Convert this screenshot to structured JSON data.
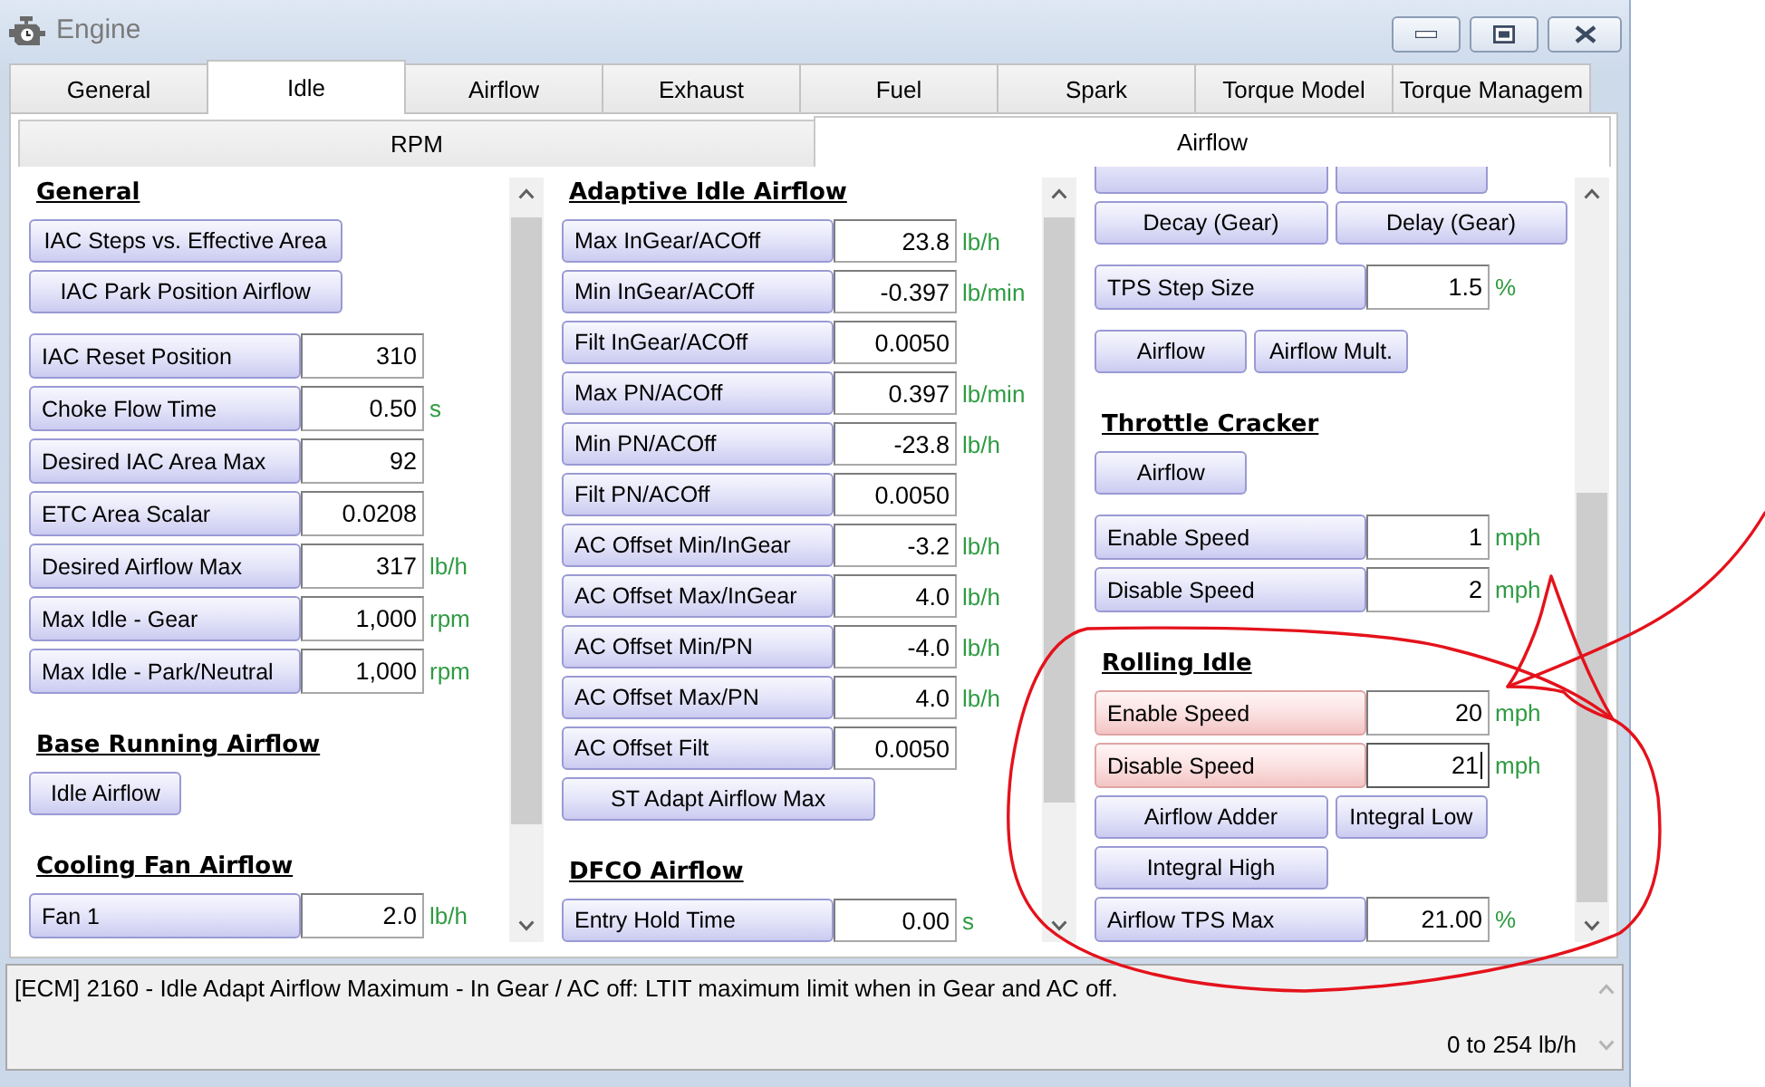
{
  "window": {
    "title": "Engine"
  },
  "tabs": [
    {
      "label": "General",
      "selected": false
    },
    {
      "label": "Idle",
      "selected": true
    },
    {
      "label": "Airflow",
      "selected": false
    },
    {
      "label": "Exhaust",
      "selected": false
    },
    {
      "label": "Fuel",
      "selected": false
    },
    {
      "label": "Spark",
      "selected": false
    },
    {
      "label": "Torque Model",
      "selected": false
    },
    {
      "label": "Torque Managem",
      "selected": false
    }
  ],
  "subtabs": [
    {
      "label": "RPM",
      "selected": false
    },
    {
      "label": "Airflow",
      "selected": true
    }
  ],
  "columns": [
    {
      "items": [
        {
          "kind": "heading",
          "text": "General"
        },
        {
          "kind": "group",
          "rows": [
            {
              "kind": "buttons",
              "buttons": [
                "IAC Steps vs. Effective Area"
              ]
            },
            {
              "kind": "buttons",
              "buttons": [
                "IAC Park Position Airflow"
              ]
            }
          ]
        },
        {
          "kind": "group",
          "rows": [
            {
              "kind": "field",
              "label": "IAC Reset Position",
              "value": "310",
              "highlighted": false,
              "focused": false
            },
            {
              "kind": "field",
              "label": "Choke Flow Time",
              "value": "0.50",
              "unit": "s",
              "highlighted": false,
              "focused": false
            },
            {
              "kind": "field",
              "label": "Desired IAC Area Max",
              "value": "92",
              "highlighted": false,
              "focused": false
            },
            {
              "kind": "field",
              "label": "ETC Area Scalar",
              "value": "0.0208",
              "highlighted": false,
              "focused": false
            },
            {
              "kind": "field",
              "label": "Desired Airflow Max",
              "value": "317",
              "unit": "lb/h",
              "highlighted": false,
              "focused": false
            },
            {
              "kind": "field",
              "label": "Max Idle - Gear",
              "value": "1,000",
              "unit": "rpm",
              "highlighted": false,
              "focused": false
            },
            {
              "kind": "field",
              "label": "Max Idle - Park/Neutral",
              "value": "1,000",
              "unit": "rpm",
              "highlighted": false,
              "focused": false
            }
          ]
        },
        {
          "kind": "heading",
          "text": "Base Running Airflow"
        },
        {
          "kind": "group",
          "rows": [
            {
              "kind": "buttons",
              "buttons": [
                "Idle Airflow"
              ]
            }
          ]
        },
        {
          "kind": "heading",
          "text": "Cooling Fan Airflow"
        },
        {
          "kind": "group",
          "rows": [
            {
              "kind": "field",
              "label": "Fan 1",
              "value": "2.0",
              "unit": "lb/h",
              "highlighted": false,
              "focused": false
            }
          ]
        }
      ]
    },
    {
      "items": [
        {
          "kind": "heading",
          "text": "Adaptive Idle Airflow"
        },
        {
          "kind": "group",
          "rows": [
            {
              "kind": "field",
              "label": "Max InGear/ACOff",
              "value": "23.8",
              "unit": "lb/h",
              "highlighted": false,
              "focused": false
            },
            {
              "kind": "field",
              "label": "Min InGear/ACOff",
              "value": "-0.397",
              "unit": "lb/min",
              "highlighted": false,
              "focused": false
            },
            {
              "kind": "field",
              "label": "Filt InGear/ACOff",
              "value": "0.0050",
              "highlighted": false,
              "focused": false
            },
            {
              "kind": "field",
              "label": "Max PN/ACOff",
              "value": "0.397",
              "unit": "lb/min",
              "highlighted": false,
              "focused": false
            },
            {
              "kind": "field",
              "label": "Min PN/ACOff",
              "value": "-23.8",
              "unit": "lb/h",
              "highlighted": false,
              "focused": false
            },
            {
              "kind": "field",
              "label": "Filt PN/ACOff",
              "value": "0.0050",
              "highlighted": false,
              "focused": false
            },
            {
              "kind": "field",
              "label": "AC Offset Min/InGear",
              "value": "-3.2",
              "unit": "lb/h",
              "highlighted": false,
              "focused": false
            },
            {
              "kind": "field",
              "label": "AC Offset Max/InGear",
              "value": "4.0",
              "unit": "lb/h",
              "highlighted": false,
              "focused": false
            },
            {
              "kind": "field",
              "label": "AC Offset Min/PN",
              "value": "-4.0",
              "unit": "lb/h",
              "highlighted": false,
              "focused": false
            },
            {
              "kind": "field",
              "label": "AC Offset Max/PN",
              "value": "4.0",
              "unit": "lb/h",
              "highlighted": false,
              "focused": false
            },
            {
              "kind": "field",
              "label": "AC Offset Filt",
              "value": "0.0050",
              "highlighted": false,
              "focused": false
            },
            {
              "kind": "buttons",
              "buttons": [
                "ST Adapt Airflow Max"
              ]
            }
          ]
        },
        {
          "kind": "heading",
          "text": "DFCO Airflow"
        },
        {
          "kind": "group",
          "rows": [
            {
              "kind": "field",
              "label": "Entry Hold Time",
              "value": "0.00",
              "unit": "s",
              "highlighted": false,
              "focused": false
            }
          ]
        }
      ]
    },
    {
      "items": [
        {
          "kind": "group",
          "rows": [
            {
              "kind": "clipped-buttons"
            },
            {
              "kind": "buttons",
              "buttons": [
                "Decay (Gear)",
                "Delay (Gear)"
              ]
            }
          ]
        },
        {
          "kind": "group",
          "rows": [
            {
              "kind": "field",
              "label": "TPS Step Size",
              "value": "1.5",
              "unit": "%",
              "highlighted": false,
              "focused": false
            }
          ]
        },
        {
          "kind": "group",
          "rows": [
            {
              "kind": "buttons",
              "buttons": [
                "Airflow",
                "Airflow Mult."
              ]
            }
          ]
        },
        {
          "kind": "heading",
          "text": "Throttle Cracker"
        },
        {
          "kind": "group",
          "rows": [
            {
              "kind": "buttons",
              "buttons": [
                "Airflow"
              ]
            }
          ]
        },
        {
          "kind": "group",
          "rows": [
            {
              "kind": "field",
              "label": "Enable Speed",
              "value": "1",
              "unit": "mph",
              "highlighted": false,
              "focused": false
            },
            {
              "kind": "field",
              "label": "Disable Speed",
              "value": "2",
              "unit": "mph",
              "highlighted": false,
              "focused": false
            }
          ]
        },
        {
          "kind": "heading",
          "text": "Rolling Idle"
        },
        {
          "kind": "group",
          "rows": [
            {
              "kind": "field",
              "label": "Enable Speed",
              "value": "20",
              "unit": "mph",
              "highlighted": true,
              "focused": false
            },
            {
              "kind": "field",
              "label": "Disable Speed",
              "value": "21",
              "unit": "mph",
              "highlighted": true,
              "focused": true
            },
            {
              "kind": "buttons",
              "buttons": [
                "Airflow Adder",
                "Integral Low"
              ]
            },
            {
              "kind": "buttons",
              "buttons": [
                "Integral High"
              ]
            },
            {
              "kind": "field",
              "label": "Airflow TPS Max",
              "value": "21.00",
              "unit": "%",
              "highlighted": false,
              "focused": false
            }
          ]
        }
      ]
    }
  ],
  "description": {
    "text": "[ECM] 2160 - Idle Adapt Airflow Maximum - In Gear / AC off: LTIT maximum limit when in Gear and AC off.",
    "range": "0 to 254 lb/h"
  }
}
